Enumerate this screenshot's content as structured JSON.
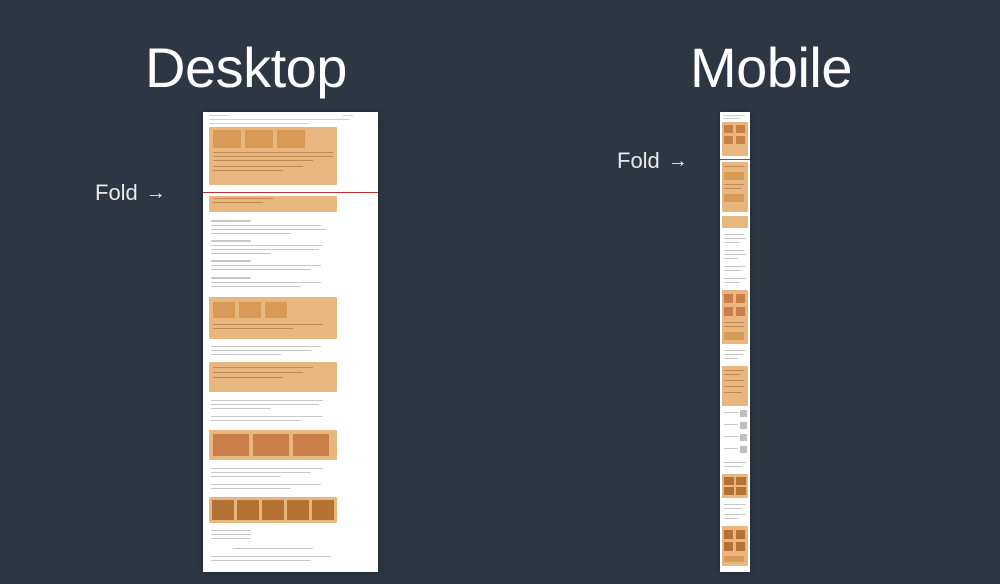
{
  "titles": {
    "desktop": "Desktop",
    "mobile": "Mobile"
  },
  "fold_label": "Fold",
  "arrow_glyph": "→",
  "colors": {
    "background": "#2d3743",
    "highlight": "#e8b77f",
    "fold_line": "#b33333",
    "page_bg": "#ffffff"
  },
  "fold": {
    "desktop_fraction": 0.17,
    "mobile_fraction": 0.1
  },
  "description": "Comparison diagram showing a long search-results style page on desktop vs mobile, with the 'fold' (initial viewport height) marked by a red line. Orange regions represent visually highlighted/ad or rich-result blocks; grey lines represent body text results."
}
